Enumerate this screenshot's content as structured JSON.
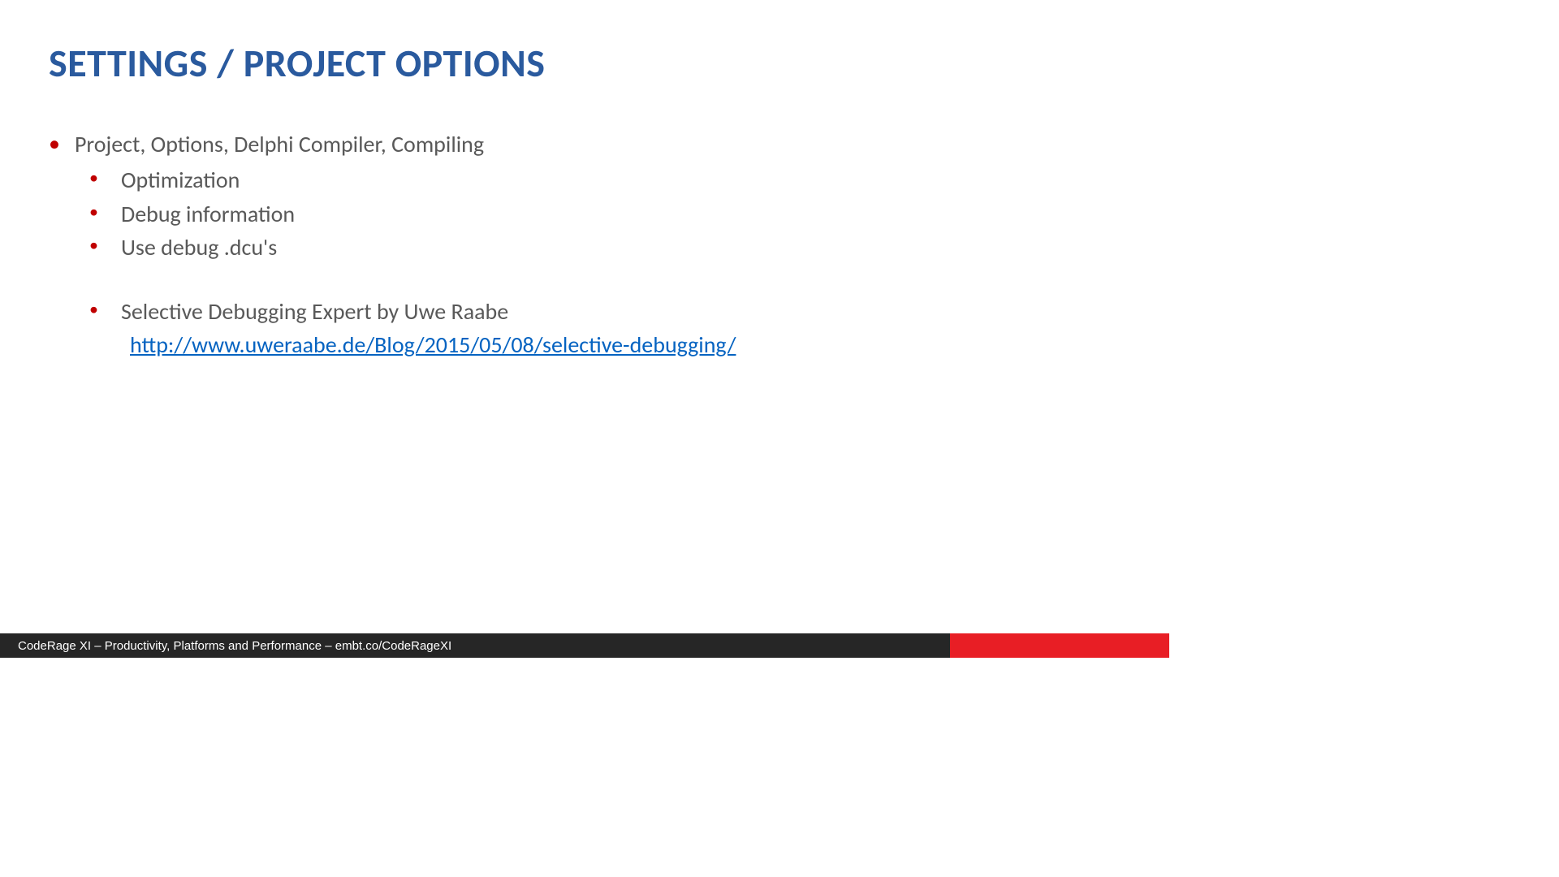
{
  "title": "SETTINGS / PROJECT OPTIONS",
  "bullets": {
    "l1": "Project, Options, Delphi Compiler, Compiling",
    "l2a": "Optimization",
    "l2b": "Debug information",
    "l2c": "Use debug .dcu's",
    "l2d": "Selective Debugging Expert by Uwe Raabe",
    "link": "http://www.uweraabe.de/Blog/2015/05/08/selective-debugging/"
  },
  "footer": "CodeRage XI – Productivity, Platforms and Performance – embt.co/CodeRageXI"
}
